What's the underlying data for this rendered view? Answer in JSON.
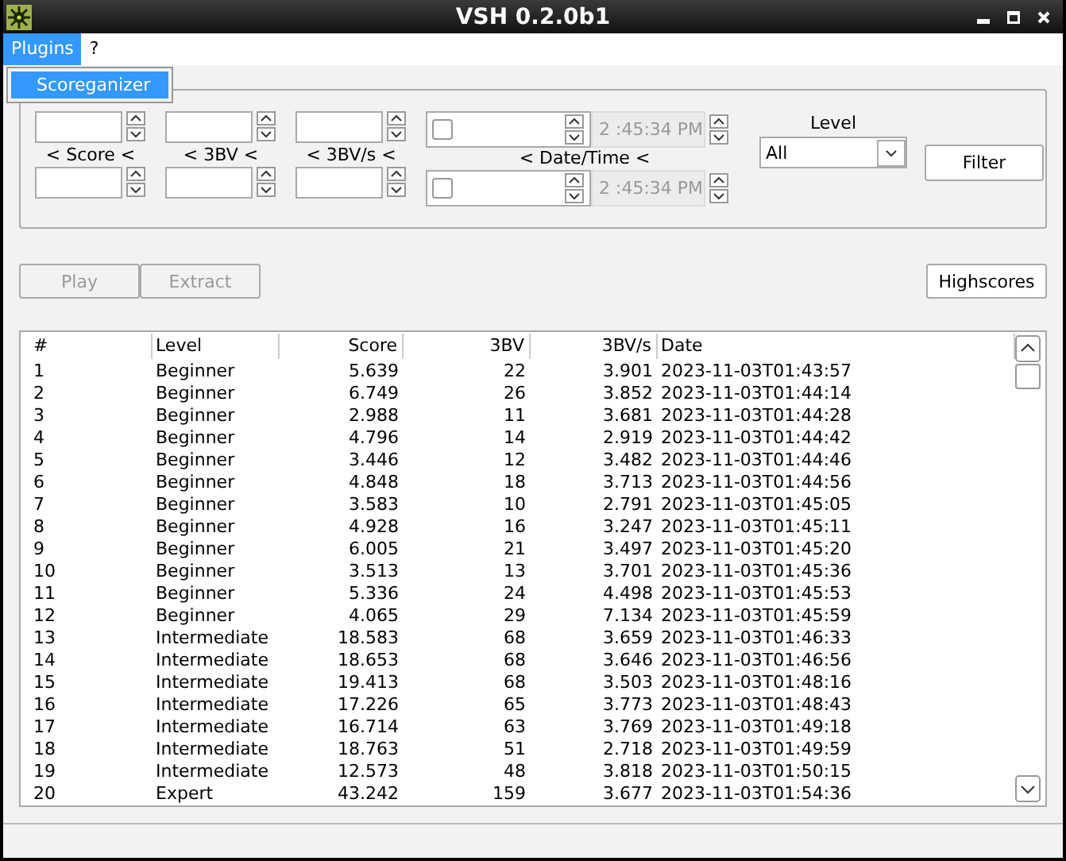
{
  "window": {
    "title": "VSH 0.2.0b1"
  },
  "menu": [
    {
      "label": "Plugins",
      "selected": true
    },
    {
      "label": "?",
      "selected": false
    }
  ],
  "open_menu": {
    "items": [
      {
        "label": "Scoreganizer",
        "selected": true
      }
    ]
  },
  "filters": {
    "ranges": [
      {
        "label": "< Score <"
      },
      {
        "label": "< 3BV <"
      },
      {
        "label": "< 3BV/s <"
      }
    ],
    "date_range": {
      "label": "< Date/Time <",
      "rows": [
        {
          "checked": false,
          "time": "2 :45:34 PM"
        },
        {
          "checked": false,
          "time": "2 :45:34 PM"
        }
      ]
    },
    "level": {
      "label": "Level",
      "value": "All"
    },
    "filter_button": "Filter"
  },
  "actions": [
    {
      "label": "Play",
      "disabled": true
    },
    {
      "label": "Extract",
      "disabled": true
    },
    {
      "label": "Highscores",
      "disabled": false
    }
  ],
  "table": {
    "columns": [
      "#",
      "Level",
      "Score",
      "3BV",
      "3BV/s",
      "Date"
    ],
    "rows": [
      [
        "1",
        "Beginner",
        "5.639",
        "22",
        "3.901",
        "2023-11-03T01:43:57"
      ],
      [
        "2",
        "Beginner",
        "6.749",
        "26",
        "3.852",
        "2023-11-03T01:44:14"
      ],
      [
        "3",
        "Beginner",
        "2.988",
        "11",
        "3.681",
        "2023-11-03T01:44:28"
      ],
      [
        "4",
        "Beginner",
        "4.796",
        "14",
        "2.919",
        "2023-11-03T01:44:42"
      ],
      [
        "5",
        "Beginner",
        "3.446",
        "12",
        "3.482",
        "2023-11-03T01:44:46"
      ],
      [
        "6",
        "Beginner",
        "4.848",
        "18",
        "3.713",
        "2023-11-03T01:44:56"
      ],
      [
        "7",
        "Beginner",
        "3.583",
        "10",
        "2.791",
        "2023-11-03T01:45:05"
      ],
      [
        "8",
        "Beginner",
        "4.928",
        "16",
        "3.247",
        "2023-11-03T01:45:11"
      ],
      [
        "9",
        "Beginner",
        "6.005",
        "21",
        "3.497",
        "2023-11-03T01:45:20"
      ],
      [
        "10",
        "Beginner",
        "3.513",
        "13",
        "3.701",
        "2023-11-03T01:45:36"
      ],
      [
        "11",
        "Beginner",
        "5.336",
        "24",
        "4.498",
        "2023-11-03T01:45:53"
      ],
      [
        "12",
        "Beginner",
        "4.065",
        "29",
        "7.134",
        "2023-11-03T01:45:59"
      ],
      [
        "13",
        "Intermediate",
        "18.583",
        "68",
        "3.659",
        "2023-11-03T01:46:33"
      ],
      [
        "14",
        "Intermediate",
        "18.653",
        "68",
        "3.646",
        "2023-11-03T01:46:56"
      ],
      [
        "15",
        "Intermediate",
        "19.413",
        "68",
        "3.503",
        "2023-11-03T01:48:16"
      ],
      [
        "16",
        "Intermediate",
        "17.226",
        "65",
        "3.773",
        "2023-11-03T01:48:43"
      ],
      [
        "17",
        "Intermediate",
        "16.714",
        "63",
        "3.769",
        "2023-11-03T01:49:18"
      ],
      [
        "18",
        "Intermediate",
        "18.763",
        "51",
        "2.718",
        "2023-11-03T01:49:59"
      ],
      [
        "19",
        "Intermediate",
        "12.573",
        "48",
        "3.818",
        "2023-11-03T01:50:15"
      ],
      [
        "20",
        "Expert",
        "43.242",
        "159",
        "3.677",
        "2023-11-03T01:54:36"
      ]
    ]
  }
}
